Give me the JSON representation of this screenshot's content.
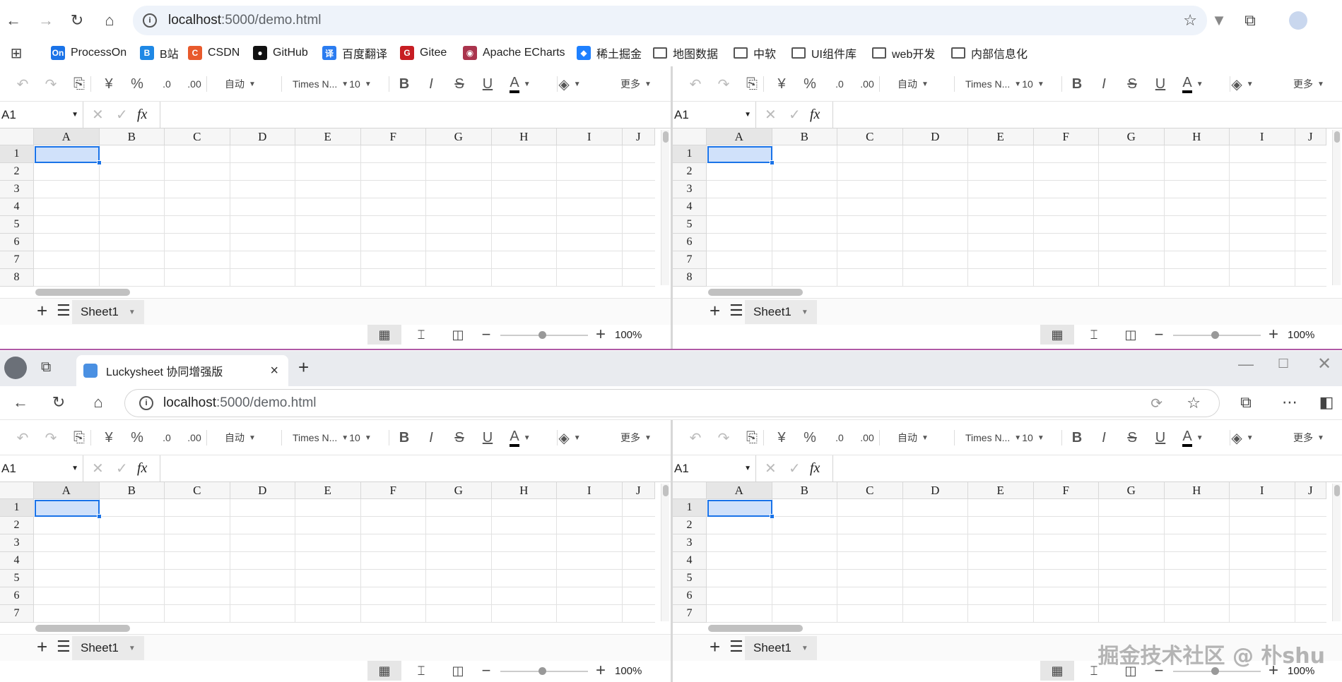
{
  "browser1": {
    "url_host": "localhost",
    "url_path": ":5000/demo.html",
    "bookmarks": [
      {
        "label": "ProcessOn",
        "icon": "processon-icon",
        "color": "#1a73e8",
        "glyph": "On"
      },
      {
        "label": "B站",
        "icon": "bilibili-icon",
        "color": "#1e88e5",
        "glyph": "B"
      },
      {
        "label": "CSDN",
        "icon": "csdn-icon",
        "color": "#e85a2c",
        "glyph": "C"
      },
      {
        "label": "GitHub",
        "icon": "github-icon",
        "color": "#111",
        "glyph": "●"
      },
      {
        "label": "百度翻译",
        "icon": "baidu-translate-icon",
        "color": "#2b7cf0",
        "glyph": "译"
      },
      {
        "label": "Gitee",
        "icon": "gitee-icon",
        "color": "#c71d23",
        "glyph": "G"
      },
      {
        "label": "Apache ECharts",
        "icon": "echarts-icon",
        "color": "#aa344d",
        "glyph": "◉"
      },
      {
        "label": "稀土掘金",
        "icon": "juejin-icon",
        "color": "#1e80ff",
        "glyph": "◆"
      },
      {
        "label": "地图数据",
        "icon": "folder-icon",
        "folder": true
      },
      {
        "label": "中软",
        "icon": "folder-icon",
        "folder": true
      },
      {
        "label": "UI组件库",
        "icon": "folder-icon",
        "folder": true
      },
      {
        "label": "web开发",
        "icon": "folder-icon",
        "folder": true
      },
      {
        "label": "内部信息化",
        "icon": "folder-icon",
        "folder": true
      }
    ]
  },
  "browser2": {
    "tab_title": "Luckysheet 协同增强版",
    "url_host": "localhost",
    "url_path": ":5000/demo.html"
  },
  "sheet": {
    "toolbar": {
      "undo": "↶",
      "redo": "↷",
      "format_painter": "⎘",
      "currency": "¥",
      "percent": "%",
      "dec_more": ".0",
      "dec_less": ".00",
      "auto": "自动",
      "font": "Times N...",
      "size": "10",
      "bold": "B",
      "italic": "I",
      "strike": "S",
      "underline": "U",
      "font_color": "A",
      "fill": "◈",
      "more": "更多"
    },
    "cell_ref": "A1",
    "fx": "fx",
    "columns": [
      "A",
      "B",
      "C",
      "D",
      "E",
      "F",
      "G",
      "H",
      "I",
      "J"
    ],
    "rows": [
      "1",
      "2",
      "3",
      "4",
      "5",
      "6",
      "7",
      "8"
    ],
    "sheet_tab": "Sheet1",
    "zoom": "100%"
  },
  "watermark": "掘金技术社区 @ 朴shu"
}
